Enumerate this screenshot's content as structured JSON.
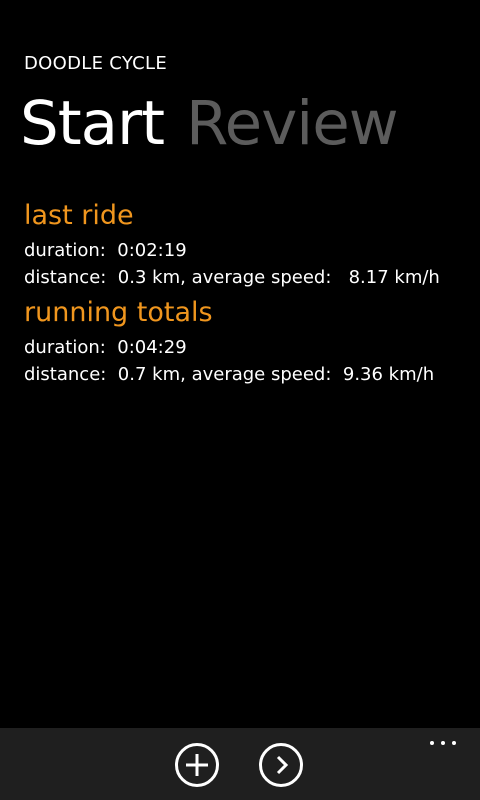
{
  "app": {
    "title": "DOODLE CYCLE"
  },
  "pivot": {
    "items": [
      {
        "label": "Start",
        "active": true
      },
      {
        "label": "Review",
        "active": false
      }
    ]
  },
  "last_ride": {
    "header": "last ride",
    "duration_label": "duration:",
    "duration_value": "0:02:19",
    "distance_label": "distance:",
    "distance_value": "0.3 km,",
    "speed_label": "average speed:",
    "speed_value": "8.17 km/h"
  },
  "running_totals": {
    "header": "running totals",
    "duration_label": "duration:",
    "duration_value": "0:04:29",
    "distance_label": "distance:",
    "distance_value": "0.7 km,",
    "speed_label": "average speed:",
    "speed_value": "9.36 km/h"
  },
  "app_bar": {
    "buttons": [
      "add-icon",
      "next-icon"
    ],
    "menu": "more-icon"
  },
  "colors": {
    "accent": "#f0961e",
    "background": "#000000",
    "appbar": "#1f1f1f",
    "pivot_inactive": "#5c5c5c"
  }
}
